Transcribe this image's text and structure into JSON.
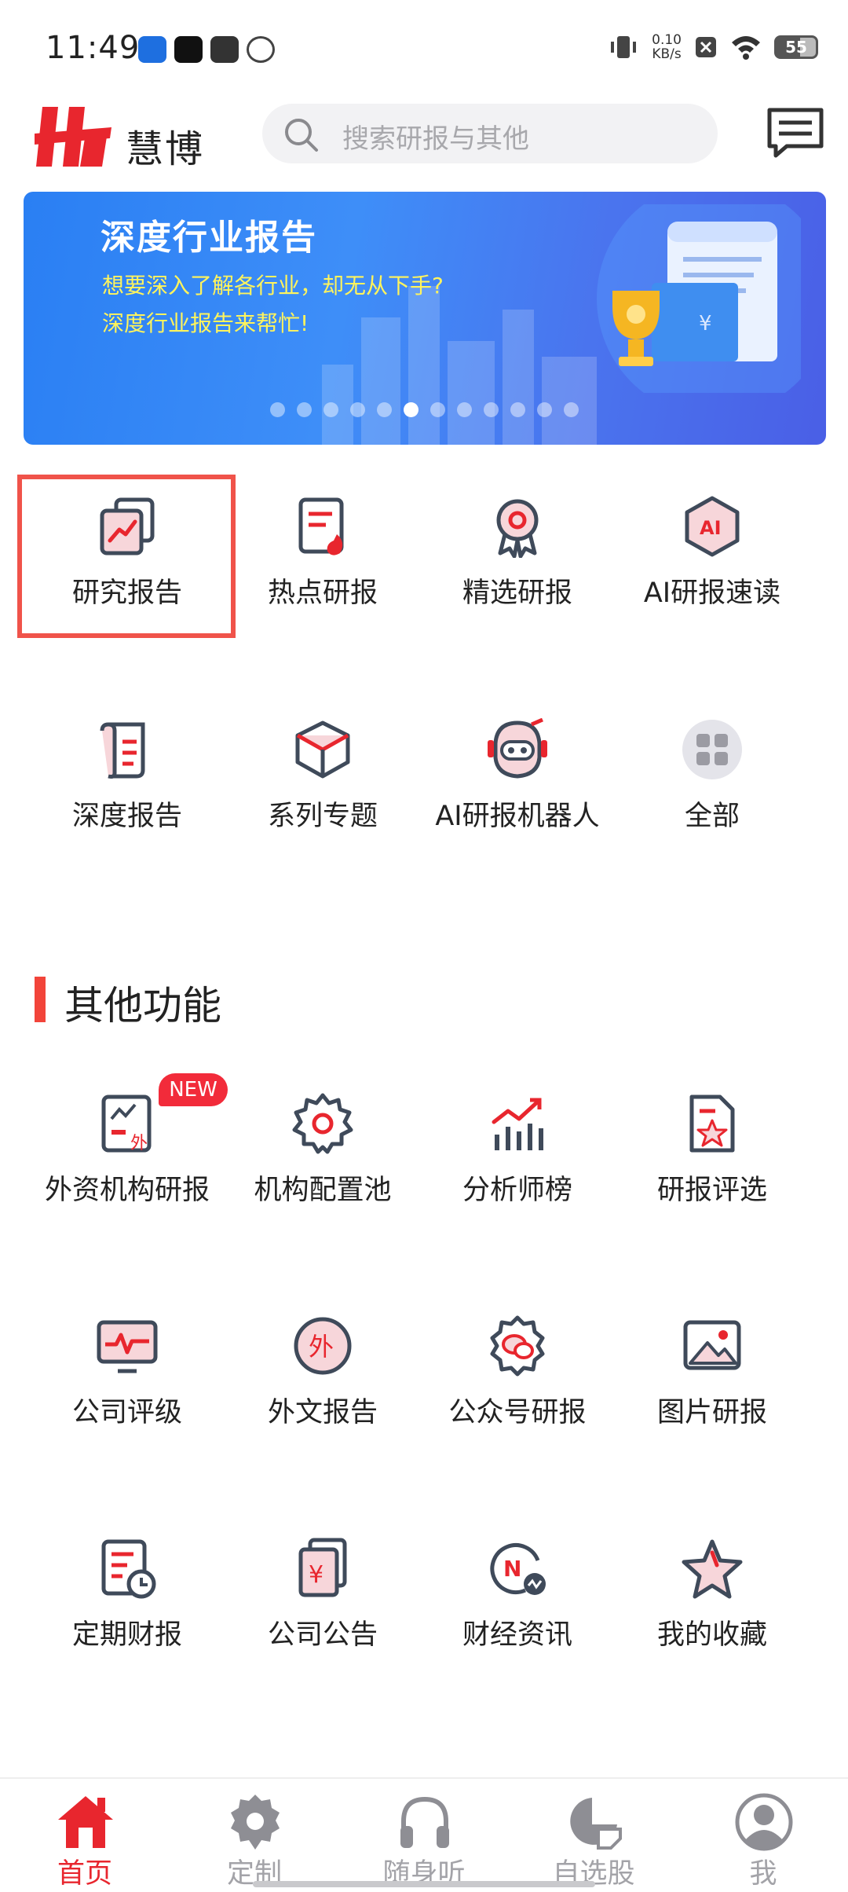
{
  "status_bar": {
    "time": "11:49",
    "net_speed_value": "0.10",
    "net_speed_unit": "KB/s",
    "battery": "55"
  },
  "header": {
    "app_name": "慧博",
    "search_placeholder": "搜索研报与其他"
  },
  "banner": {
    "title": "深度行业报告",
    "subtitle_line1": "想要深入了解各行业，却无从下手?",
    "subtitle_line2": "深度行业报告来帮忙!",
    "page_count": 12,
    "active_index": 5
  },
  "main_menu": [
    {
      "label": "研究报告",
      "icon": "trend-chart-icon"
    },
    {
      "label": "热点研报",
      "icon": "hot-report-icon"
    },
    {
      "label": "精选研报",
      "icon": "award-badge-icon"
    },
    {
      "label": "AI研报速读",
      "icon": "ai-hexagon-icon"
    },
    {
      "label": "深度报告",
      "icon": "scroll-document-icon"
    },
    {
      "label": "系列专题",
      "icon": "cube-icon"
    },
    {
      "label": "AI研报机器人",
      "icon": "robot-icon"
    },
    {
      "label": "全部",
      "icon": "grid-apps-icon"
    }
  ],
  "other_section": {
    "title": "其他功能",
    "new_badge": "NEW",
    "items": [
      {
        "label": "外资机构研报",
        "icon": "foreign-chart-icon"
      },
      {
        "label": "机构配置池",
        "icon": "gear-icon"
      },
      {
        "label": "分析师榜",
        "icon": "bar-chart-icon"
      },
      {
        "label": "研报评选",
        "icon": "star-document-icon"
      },
      {
        "label": "公司评级",
        "icon": "monitor-pulse-icon"
      },
      {
        "label": "外文报告",
        "icon": "foreign-circle-icon"
      },
      {
        "label": "公众号研报",
        "icon": "wechat-badge-icon"
      },
      {
        "label": "图片研报",
        "icon": "image-icon"
      },
      {
        "label": "定期财报",
        "icon": "clock-document-icon"
      },
      {
        "label": "公司公告",
        "icon": "yuan-document-icon"
      },
      {
        "label": "财经资讯",
        "icon": "news-circle-icon"
      },
      {
        "label": "我的收藏",
        "icon": "star-icon"
      }
    ]
  },
  "bottom_nav": [
    {
      "label": "首页",
      "icon": "home-icon",
      "active": true
    },
    {
      "label": "定制",
      "icon": "settings-gear-icon",
      "active": false
    },
    {
      "label": "随身听",
      "icon": "headphones-icon",
      "active": false
    },
    {
      "label": "自选股",
      "icon": "pie-chart-icon",
      "active": false
    },
    {
      "label": "我",
      "icon": "user-icon",
      "active": false
    }
  ],
  "colors": {
    "brand_red": "#E8262E",
    "accent_pink": "#F7D6DA",
    "icon_gray": "#3F4A5A",
    "banner_blue": "#3E8EF8"
  }
}
